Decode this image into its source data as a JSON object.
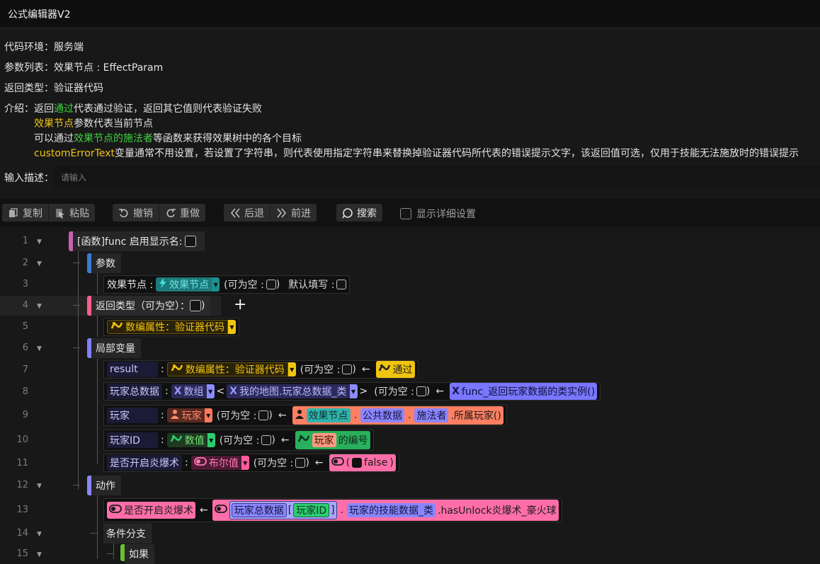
{
  "window": {
    "title": "公式编辑器V2"
  },
  "info": {
    "env_label": "代码环境：",
    "env_value": "服务端",
    "params_label": "参数列表：",
    "params_value": "效果节点 : EffectParam",
    "return_label": "返回类型：",
    "return_value": "验证器代码",
    "intro_label": "介绍：",
    "intro_l1_a": "返回",
    "intro_l1_b": "通过",
    "intro_l1_c": "代表通过验证，返回其它值则代表验证失败",
    "intro_l2_a": "效果节点",
    "intro_l2_b": "参数代表当前节点",
    "intro_l3_a": "可以通过",
    "intro_l3_b": "效果节点的施法者",
    "intro_l3_c": "等函数来获得效果树中的各个目标",
    "intro_l4_a": "customErrorText",
    "intro_l4_b": "变量通常不用设置，若设置了字符串，则代表使用指定字符串来替换掉验证器代码所代表的错误提示文字，该返回值可选，仅用于技能无法施放时的错误提示"
  },
  "description": {
    "label": "输入描述：",
    "placeholder": "请输入"
  },
  "toolbar": {
    "copy": "复制",
    "paste": "粘贴",
    "undo": "撤销",
    "redo": "重做",
    "back": "后退",
    "forward": "前进",
    "search": "搜索",
    "detail": "显示详细设置"
  },
  "colors": {
    "green": "#3fd43f",
    "yellow": "#f0c419",
    "function": "#c75fb3",
    "param": "#3a7bd5",
    "return": "#ff5c8a",
    "local": "#8080ff",
    "action": "#8b86ff",
    "branch": "#6abe30"
  },
  "icons": [
    "copy-icon",
    "paste-icon",
    "undo-icon",
    "redo-icon",
    "back-icon",
    "forward-icon",
    "search-icon",
    "lightning-icon",
    "effect-data-icon",
    "variable-icon",
    "player-icon",
    "number-icon",
    "boolean-icon",
    "plus-icon"
  ],
  "lines": [
    "1",
    "2",
    "3",
    "4",
    "5",
    "6",
    "7",
    "8",
    "9",
    "10",
    "11",
    "12",
    "13",
    "14",
    "15"
  ],
  "code": {
    "fn": "[函数]func 启用显示名:",
    "params": "参数",
    "p_name": "效果节点 :",
    "p_type": "效果节点",
    "nullable": "(可为空 :",
    "close": ")",
    "default_fill": "默认填写 :",
    "return_type": "返回类型（可为空）：",
    "return_close": ")",
    "return_val": "数编属性：验证器代码",
    "locals": "局部变量",
    "v1_name": "result",
    "colon": ":",
    "v1_type": "数编属性：验证器代码",
    "nullable2": "(可为空 :",
    "v1_val": "通过",
    "v2_name": "玩家总数据",
    "v2_type": "数组",
    "lt": "<",
    "v2_sub": "我的地图.玩家总数据_类",
    "gt": ">",
    "v2_val": "func_返回玩家数据的类实例()",
    "v3_name": "玩家",
    "v3_type": "玩家",
    "v3_p1": "效果节点",
    "v3_p2": "公共数据",
    "v3_p3": "施法者",
    "v3_p4": ".所属玩家()",
    "v4_name": "玩家ID",
    "v4_type": "数值",
    "v4_p1": "玩家",
    "v4_p2": "的编号",
    "v5_name": "是否开启炎爆术",
    "v5_type": "布尔值",
    "v5_val": "false",
    "actions": "动作",
    "a_name": "是否开启炎爆术",
    "a_p1": "玩家总数据",
    "a_p2": "玩家ID",
    "a_p3": "玩家的技能数据_类",
    "a_p4": ".hasUnlock炎爆术_豪火球",
    "branch": "条件分支",
    "if": "如果",
    "arrow": "←",
    "dot": ".",
    "lbr": "[",
    "rbr": "]",
    "lp": "(",
    "rp": ")"
  }
}
